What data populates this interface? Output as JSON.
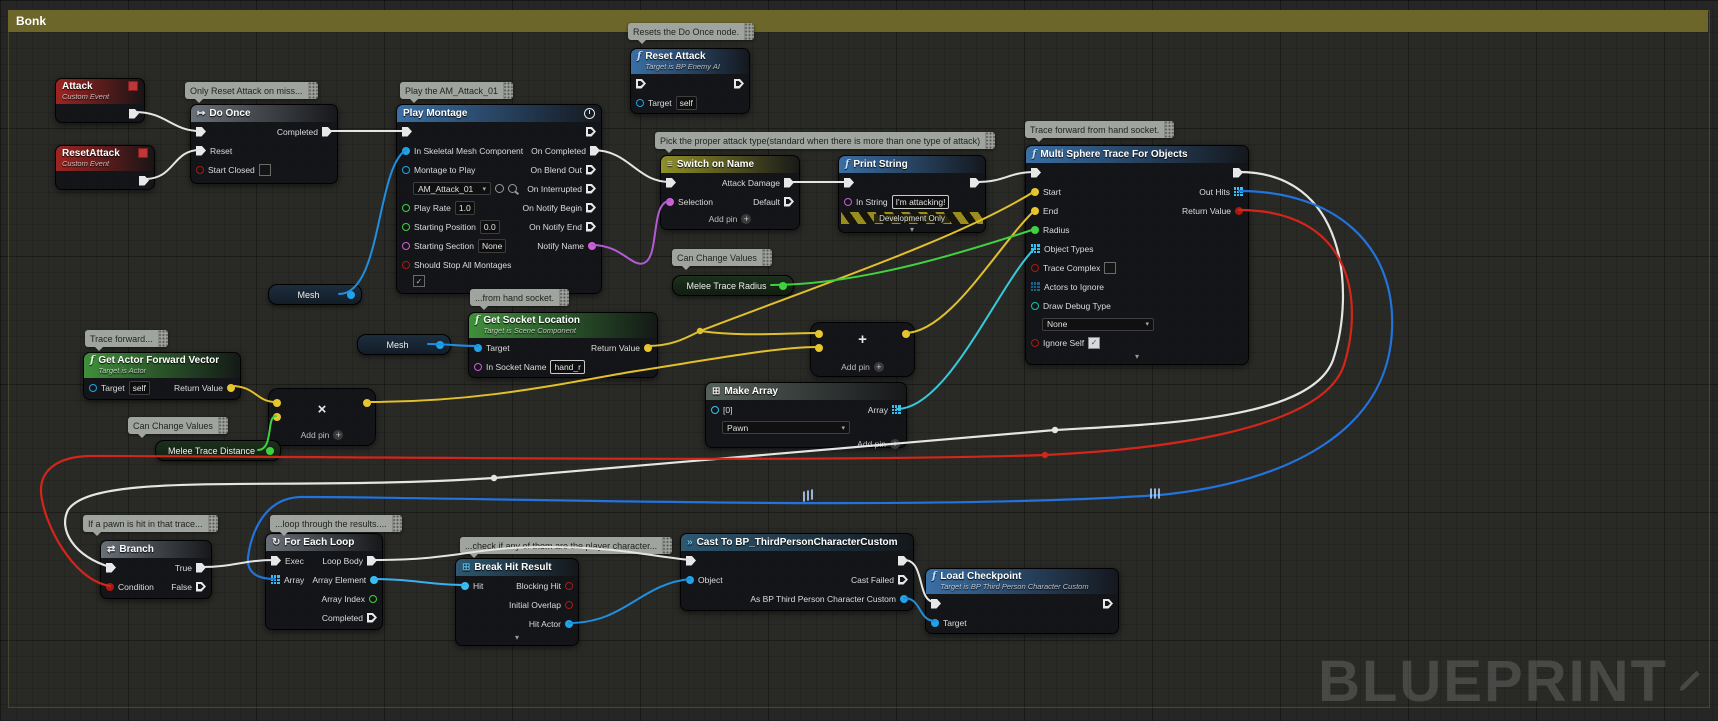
{
  "graph": {
    "comment_title": "Bonk",
    "watermark": "BLUEPRINT"
  },
  "ui": {
    "add_pin": "Add pin",
    "dev_only": "Development Only"
  },
  "comments": {
    "reset_on_miss": "Only Reset Attack on miss...",
    "play_am": "Play the AM_Attack_01",
    "resets_do_once": "Resets the Do Once node.",
    "pick_attack": "Pick the proper attack type(standard when there is more than one type of attack)",
    "trace_hand": "Trace forward from hand socket.",
    "from_hand": "...from hand socket.",
    "trace_forward": "Trace forward...",
    "can_change_a": "Can Change Values",
    "can_change_b": "Can Change Values",
    "pawn_hit": "If a pawn is hit in that trace...",
    "loop_results": "...loop through the results....",
    "check_player": "...check if any of them are the player character..."
  },
  "nodes": {
    "attack_event": {
      "title": "Attack",
      "subtitle": "Custom Event"
    },
    "resetattack_event": {
      "title": "ResetAttack",
      "subtitle": "Custom Event"
    },
    "do_once": {
      "title": "Do Once",
      "pins": {
        "completed": "Completed",
        "reset": "Reset",
        "start_closed": "Start Closed"
      }
    },
    "play_montage": {
      "title": "Play Montage",
      "pins": {
        "in_skeletal": "In Skeletal Mesh Component",
        "montage": "Montage to Play",
        "play_rate": "Play Rate",
        "starting_position": "Starting Position",
        "starting_section": "Starting Section",
        "should_stop": "Should Stop All Montages",
        "on_completed": "On Completed",
        "on_blend_out": "On Blend Out",
        "on_interrupted": "On Interrupted",
        "on_notify_begin": "On Notify Begin",
        "on_notify_end": "On Notify End",
        "notify_name": "Notify Name"
      },
      "values": {
        "montage": "AM_Attack_01",
        "play_rate": "1.0",
        "starting_position": "0.0",
        "starting_section": "None"
      }
    },
    "reset_attack_call": {
      "title": "Reset Attack",
      "subtitle": "Target is BP Enemy AI",
      "pins": {
        "target": "Target"
      },
      "values": {
        "target": "self"
      }
    },
    "switch_on_name": {
      "title": "Switch on Name",
      "pins": {
        "selection": "Selection",
        "attack_damage": "Attack Damage",
        "default": "Default"
      }
    },
    "print_string": {
      "title": "Print String",
      "pins": {
        "in_string": "In String"
      },
      "values": {
        "in_string": "I'm attacking!"
      }
    },
    "multi_sphere": {
      "title": "Multi Sphere Trace For Objects",
      "pins": {
        "start": "Start",
        "end": "End",
        "radius": "Radius",
        "object_types": "Object Types",
        "trace_complex": "Trace Complex",
        "actors_to_ignore": "Actors to Ignore",
        "draw_debug_type": "Draw Debug Type",
        "ignore_self": "Ignore Self",
        "out_hits": "Out Hits",
        "return_value": "Return Value"
      },
      "values": {
        "draw_debug_type": "None"
      }
    },
    "get_socket_location": {
      "title": "Get Socket Location",
      "subtitle": "Target is Scene Component",
      "pins": {
        "target": "Target",
        "in_socket_name": "In Socket Name",
        "return_value": "Return Value"
      },
      "values": {
        "in_socket_name": "hand_r"
      }
    },
    "get_forward_vector": {
      "title": "Get Actor Forward Vector",
      "subtitle": "Target is Actor",
      "pins": {
        "target": "Target",
        "return_value": "Return Value"
      },
      "values": {
        "target": "self"
      }
    },
    "multiply": {
      "symbol": "×"
    },
    "add": {
      "symbol": "+"
    },
    "make_array": {
      "title": "Make Array",
      "pins": {
        "elem0": "[0]",
        "array": "Array"
      },
      "values": {
        "elem0": "Pawn"
      }
    },
    "branch": {
      "title": "Branch",
      "pins": {
        "condition": "Condition",
        "true": "True",
        "false": "False"
      }
    },
    "foreach": {
      "title": "For Each Loop",
      "pins": {
        "exec": "Exec",
        "array": "Array",
        "loop_body": "Loop Body",
        "array_element": "Array Element",
        "array_index": "Array Index",
        "completed": "Completed"
      }
    },
    "break_hit": {
      "title": "Break Hit Result",
      "pins": {
        "hit": "Hit",
        "blocking_hit": "Blocking Hit",
        "initial_overlap": "Initial Overlap",
        "hit_actor": "Hit Actor"
      }
    },
    "cast": {
      "title": "Cast To BP_ThirdPersonCharacterCustom",
      "pins": {
        "object": "Object",
        "cast_failed": "Cast Failed",
        "as_bp": "As BP Third Person Character Custom"
      }
    },
    "load_checkpoint": {
      "title": "Load Checkpoint",
      "subtitle": "Target is BP Third Person Character Custom",
      "pins": {
        "target": "Target"
      }
    },
    "var_mesh_a": {
      "label": "Mesh"
    },
    "var_mesh_b": {
      "label": "Mesh"
    },
    "var_melee_radius": {
      "label": "Melee Trace Radius"
    },
    "var_melee_distance": {
      "label": "Melee Trace Distance"
    }
  }
}
